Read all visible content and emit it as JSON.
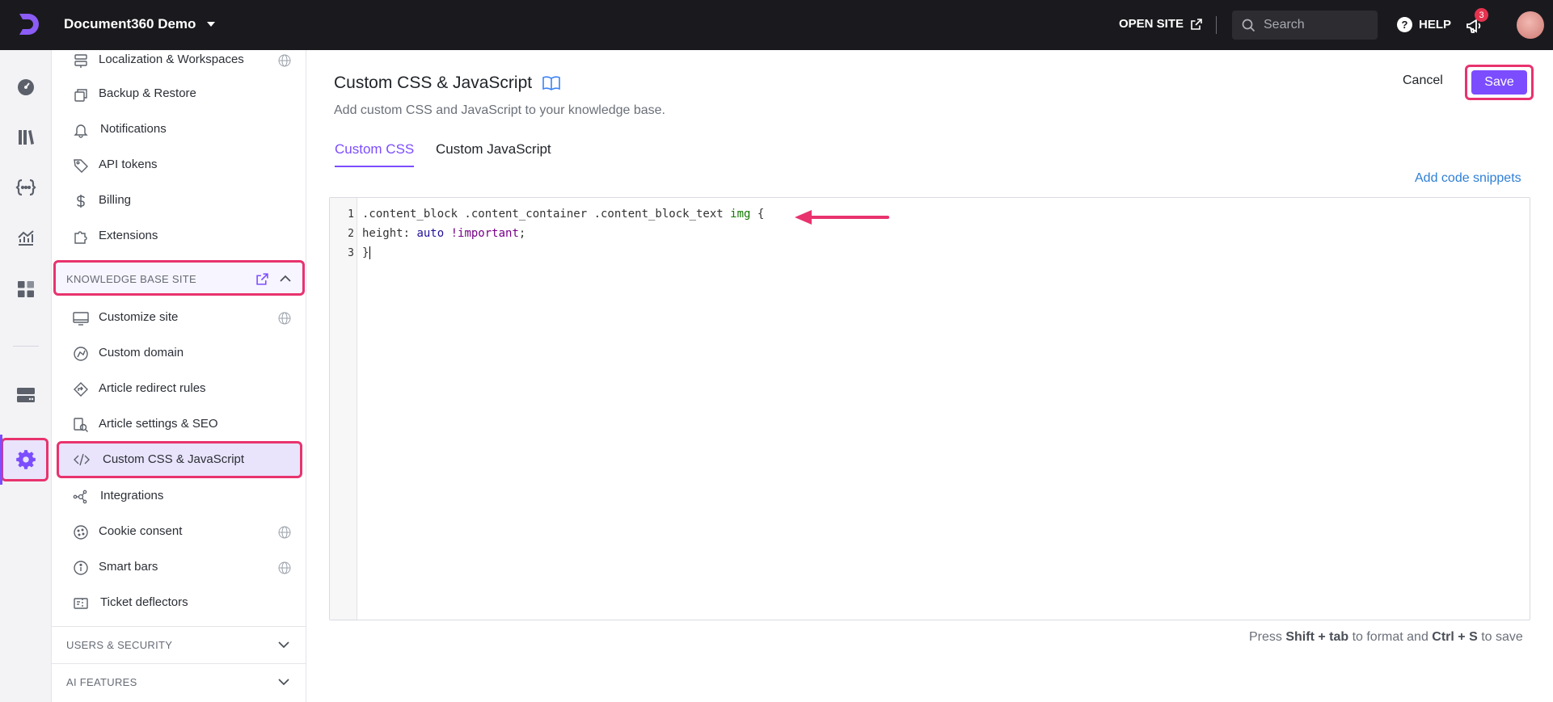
{
  "topbar": {
    "project_name": "Document360 Demo",
    "open_site_label": "OPEN SITE",
    "search_placeholder": "Search",
    "help_label": "HELP",
    "notification_count": "3"
  },
  "rail": {
    "items": [
      "dashboard-icon",
      "documentation-icon",
      "api-icon",
      "analytics-icon",
      "widgets-icon",
      "drive-icon",
      "settings-icon"
    ],
    "active": "settings-icon",
    "accent_color": "#7c4dff",
    "highlight_color": "#e8336e"
  },
  "sidebar": {
    "top_items": [
      {
        "label": "Localization & Workspaces",
        "icon": "localization-icon",
        "globe": true
      },
      {
        "label": "Backup & Restore",
        "icon": "backup-icon",
        "globe": false
      },
      {
        "label": "Notifications",
        "icon": "notifications-icon",
        "globe": false
      },
      {
        "label": "API tokens",
        "icon": "tag-icon",
        "globe": false
      },
      {
        "label": "Billing",
        "icon": "dollar-icon",
        "globe": false
      },
      {
        "label": "Extensions",
        "icon": "puzzle-icon",
        "globe": false
      }
    ],
    "kb_section": {
      "label": "KNOWLEDGE BASE SITE",
      "items": [
        {
          "label": "Customize site",
          "icon": "monitor-icon",
          "globe": true
        },
        {
          "label": "Custom domain",
          "icon": "domain-icon",
          "globe": false
        },
        {
          "label": "Article redirect rules",
          "icon": "redirect-icon",
          "globe": false
        },
        {
          "label": "Article settings & SEO",
          "icon": "seo-icon",
          "globe": false
        },
        {
          "label": "Custom CSS & JavaScript",
          "icon": "code-icon",
          "globe": false,
          "active": true
        },
        {
          "label": "Integrations",
          "icon": "integrations-icon",
          "globe": false
        },
        {
          "label": "Cookie consent",
          "icon": "cookie-icon",
          "globe": true
        },
        {
          "label": "Smart bars",
          "icon": "info-icon",
          "globe": true
        },
        {
          "label": "Ticket deflectors",
          "icon": "ticket-icon",
          "globe": false
        }
      ]
    },
    "users_section": {
      "label": "USERS & SECURITY"
    },
    "ai_section": {
      "label": "AI FEATURES"
    }
  },
  "main": {
    "title": "Custom CSS & JavaScript",
    "subtitle": "Add custom CSS and JavaScript to your knowledge base.",
    "cancel_label": "Cancel",
    "save_label": "Save",
    "tabs": [
      {
        "label": "Custom CSS",
        "active": true
      },
      {
        "label": "Custom JavaScript",
        "active": false
      }
    ],
    "add_snippets_label": "Add code snippets",
    "editor": {
      "line_numbers": [
        "1",
        "2",
        "3"
      ],
      "line1_selector": ".content_block .content_container .content_block_text ",
      "line1_tag": "img",
      "line1_brace": " {",
      "line2_prop": "height: ",
      "line2_value": "auto",
      "line2_important": " !important",
      "line2_end": ";",
      "line3": "}"
    },
    "hint": {
      "prefix": "Press ",
      "key1": "Shift + tab",
      "middle": " to format and ",
      "key2": "Ctrl + S",
      "suffix": " to save"
    }
  }
}
